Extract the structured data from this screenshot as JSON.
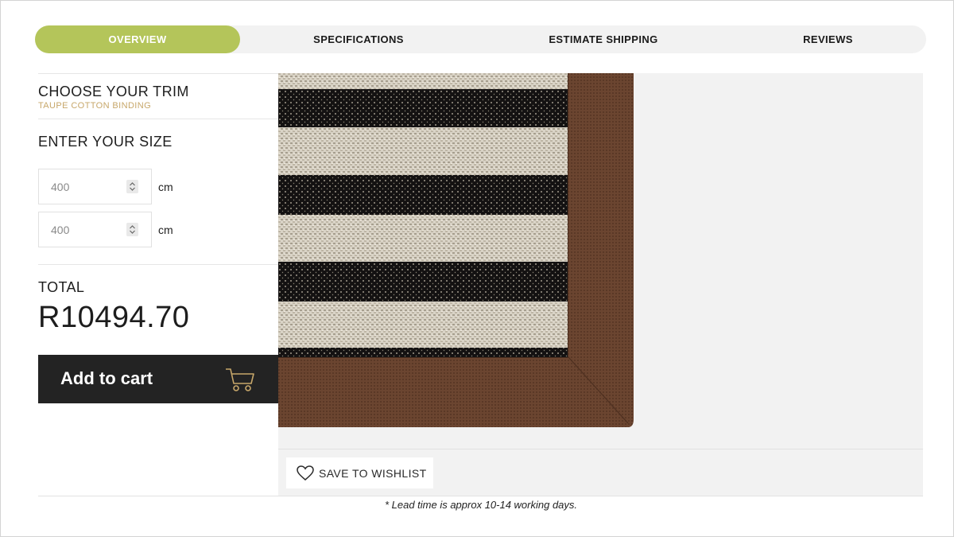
{
  "tabs": [
    {
      "label": "OVERVIEW",
      "active": true
    },
    {
      "label": "SPECIFICATIONS",
      "active": false
    },
    {
      "label": "ESTIMATE SHIPPING",
      "active": false
    },
    {
      "label": "REVIEWS",
      "active": false
    }
  ],
  "trim": {
    "title": "CHOOSE YOUR TRIM",
    "selected": "TAUPE COTTON BINDING"
  },
  "size": {
    "title": "ENTER YOUR SIZE",
    "width_value": "400",
    "length_value": "400",
    "unit": "cm"
  },
  "total": {
    "label": "TOTAL",
    "value": "R10494.70"
  },
  "cart": {
    "label": "Add to cart",
    "icon": "shopping-cart-icon"
  },
  "wishlist": {
    "label": "SAVE TO WISHLIST",
    "icon": "heart-icon"
  },
  "lead_time": "* Lead time is approx 10-14 working days.",
  "colors": {
    "accent_green": "#b4c55a",
    "trim_gold": "#c7a76a",
    "cart_bg": "#232323",
    "panel_bg": "#f2f2f2",
    "rug_border_brown": "#6b4530"
  }
}
